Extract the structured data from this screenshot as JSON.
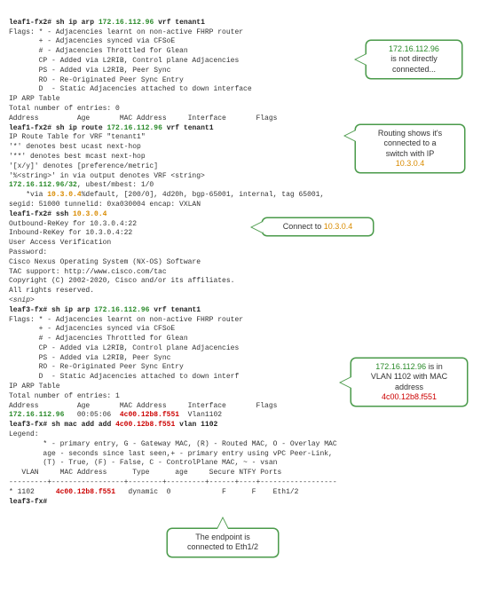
{
  "prompts": {
    "leaf1fx2": "leaf1-fx2#",
    "leaf3fx": "leaf3-fx#"
  },
  "cmd": {
    "sh_ip_arp": "sh ip arp",
    "sh_ip_route": "sh ip route",
    "ssh": "ssh",
    "sh_mac_add_add": "sh mac add add",
    "vrf_t1": "vrf tenant1",
    "vlan1102": "vlan 1102"
  },
  "ips": {
    "target": "172.16.112.96",
    "targetMask": "172.16.112.96/32",
    "nh": "10.3.0.4"
  },
  "mac": "4c00.12b8.f551",
  "arp_flags": {
    "star": "Flags: * - Adjacencies learnt on non-active FHRP router",
    "plus": "       + - Adjacencies synced via CFSoE",
    "hash": "       # - Adjacencies Throttled for Glean",
    "cp": "       CP - Added via L2RIB, Control plane Adjacencies",
    "ps": "       PS - Added via L2RIB, Peer Sync",
    "ro": "       RO - Re-Originated Peer Sync Entry",
    "d1": "       D  - Static Adjacencies attached to down interface",
    "d2": "       D  - Static Adjacencies attached to down interf"
  },
  "text": {
    "arp_table": "IP ARP Table",
    "entries0": "Total number of entries: 0",
    "entries1": "Total number of entries: 1",
    "arp_cols": "Address         Age       MAC Address     Interface       Flags",
    "route_title": "IP Route Table for VRF \"tenant1\"",
    "route_l1": "'*' denotes best ucast next-hop",
    "route_l2": "'**' denotes best mcast next-hop",
    "route_l3": "'[x/y]' denotes [preference/metric]",
    "route_l4": "'%<string>' in via output denotes VRF <string>",
    "route_um": ", ubest/mbest: 1/0",
    "route_via_pre": "    *via ",
    "route_via_post": "%default, [200/0], 4d20h, bgp-65001, internal, tag 65001,",
    "route_seg": "segid: 51000 tunnelid: 0xa030004 encap: VXLAN",
    "ssh_out": "Outbound-ReKey for 10.3.0.4:22",
    "ssh_in": "Inbound-ReKey for 10.3.0.4:22",
    "uav": "User Access Verification",
    "pw": "Password:",
    "nxos": "Cisco Nexus Operating System (NX-OS) Software",
    "tac": "TAC support: http://www.cisco.com/tac",
    "copy": "Copyright (C) 2002-2020, Cisco and/or its affiliates.",
    "rights": "All rights reserved.",
    "snip": "<snip>",
    "arp_row_age": "   00:05:06  ",
    "arp_row_if": "  Vlan1102",
    "mac_legend": "Legend:",
    "mac_l1": "        * - primary entry, G - Gateway MAC, (R) - Routed MAC, O - Overlay MAC",
    "mac_l2": "        age - seconds since last seen,+ - primary entry using vPC Peer-Link,",
    "mac_l3": "        (T) - True, (F) - False, C - ControlPlane MAC, ~ - vsan",
    "mac_cols": "   VLAN     MAC Address      Type      age     Secure NTFY Ports",
    "mac_dash": "---------+-----------------+--------+---------+------+----+------------------",
    "mac_row_pre": "* 1102     ",
    "mac_row_post": "   dynamic  0            F      F    Eth1/2"
  },
  "callouts": {
    "c1a": "172.16.112.96",
    "c1b": "is not directly",
    "c1c": "connected...",
    "c2a": "Routing shows it's",
    "c2b": "connected to a",
    "c2c": "switch with IP",
    "c2d": "10.3.0.4",
    "c3a": "Connect to ",
    "c3b": "10.3.0.4",
    "c4a": "172.16.112.96",
    "c4b": " is in",
    "c4c": "VLAN 1102 with MAC",
    "c4d": "address",
    "c4e": "4c00.12b8.f551",
    "c5a": "The endpoint is",
    "c5b": "connected to Eth1/2"
  }
}
